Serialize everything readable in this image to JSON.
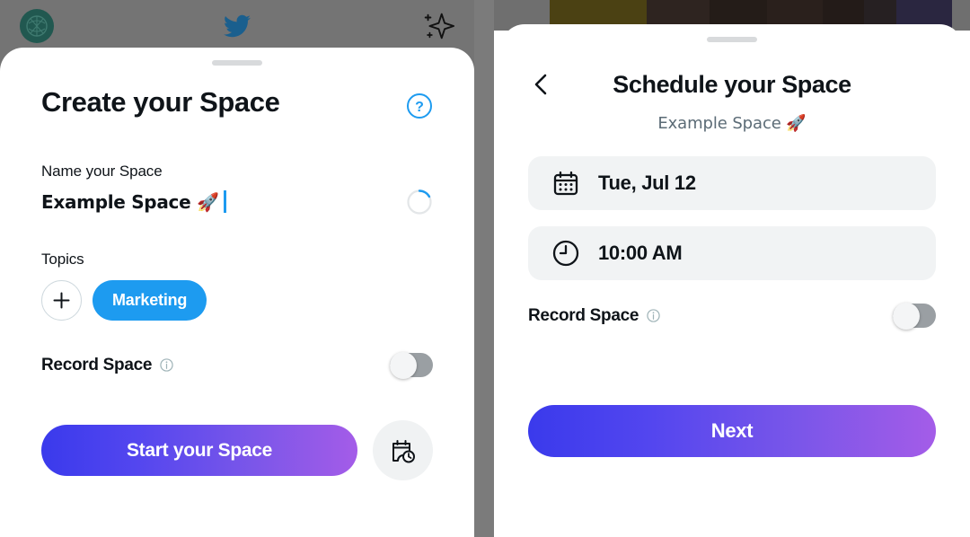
{
  "left_screen": {
    "topbar": {
      "avatar_icon": "avatar-circle-icon",
      "logo_icon": "twitter-bird-icon",
      "sparkle_icon": "sparkle-icon"
    },
    "sheet": {
      "title": "Create your Space",
      "help_icon": "help-circle-icon",
      "name_field": {
        "label": "Name your Space",
        "value": "Example Space 🚀",
        "spinner_icon": "loading-spinner-icon"
      },
      "topics": {
        "label": "Topics",
        "add_icon": "plus-icon",
        "selected": [
          "Marketing"
        ]
      },
      "record": {
        "label": "Record Space",
        "info_icon": "info-circle-icon",
        "toggle_state": "off"
      },
      "cta": {
        "primary_label": "Start your Space",
        "schedule_icon": "calendar-clock-icon"
      }
    }
  },
  "right_screen": {
    "background_bands": [
      "#6f6f6f",
      "#4b4113",
      "#2e2420",
      "#241c18",
      "#2a201c",
      "#231b18",
      "#262022",
      "#2a2640",
      "#6f6f6f"
    ],
    "sheet": {
      "back_icon": "chevron-left-icon",
      "title": "Schedule your Space",
      "subtitle": "Example Space 🚀",
      "date_row": {
        "icon": "calendar-icon",
        "value": "Tue, Jul 12"
      },
      "time_row": {
        "icon": "clock-icon",
        "value": "10:00 AM"
      },
      "record": {
        "label": "Record Space",
        "info_icon": "info-circle-icon",
        "toggle_state": "off"
      },
      "cta": {
        "label": "Next"
      }
    }
  },
  "colors": {
    "twitter_blue": "#1D9BF0",
    "gradient_start": "#3A3AEC",
    "gradient_end": "#A45CE8",
    "text_primary": "#0F1419",
    "text_secondary": "#5B6B76",
    "field_bg": "#F1F3F4",
    "toggle_off": "#9A9FA3"
  }
}
